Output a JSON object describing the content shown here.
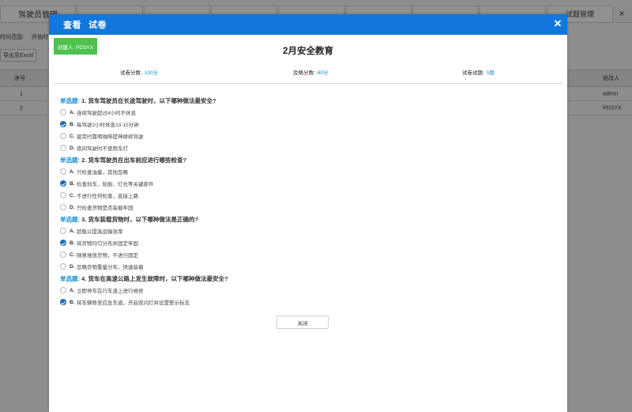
{
  "background": {
    "tabs": [
      "驾驶员管理",
      "",
      "",
      "",
      "",
      "",
      "",
      "",
      "试题管理"
    ],
    "tab_close": "×",
    "filter_label": "时间范围:",
    "filter_start": "开始时",
    "export_button": "导出至Excel",
    "table_headers": {
      "index": "序号",
      "modifier": "修改人"
    },
    "rows": [
      {
        "index": "1",
        "modifier": "admin"
      },
      {
        "index": "2",
        "modifier": "PDSYX"
      }
    ]
  },
  "modal": {
    "title_part1": "查看",
    "title_part2": "试卷",
    "close_icon": "×",
    "creator": "创建人: PDSYX",
    "paper_title": "2月安全教育",
    "meta": {
      "score_label": "试卷分数:",
      "score_value": "100分",
      "pass_label": "及格分数:",
      "pass_value": "60分",
      "count_label": "试卷试题:",
      "count_value": "5题"
    },
    "questions": [
      {
        "type": "单选题:",
        "number": "1.",
        "text": "货车驾驶员在长途驾驶时，以下哪种做法最安全?",
        "options": [
          {
            "letter": "A.",
            "text": "连续驾驶超过4小时不休息",
            "checked": false
          },
          {
            "letter": "B.",
            "text": "每驾驶2小时休息10-15分钟",
            "checked": true
          },
          {
            "letter": "C.",
            "text": "疲劳时靠喝咖啡提神继续驾驶",
            "checked": false
          },
          {
            "letter": "D.",
            "text": "夜间驾驶时不使用车灯",
            "checked": false
          }
        ]
      },
      {
        "type": "单选题:",
        "number": "2.",
        "text": "货车驾驶员在出车前应进行哪些检查?",
        "options": [
          {
            "letter": "A.",
            "text": "只检查油量，其他忽略",
            "checked": false
          },
          {
            "letter": "B.",
            "text": "检查刹车、轮胎、灯光等关键部件",
            "checked": true
          },
          {
            "letter": "C.",
            "text": "不进行任何检查，直接上路",
            "checked": false
          },
          {
            "letter": "D.",
            "text": "只检查货物是否装载牢固",
            "checked": false
          }
        ]
      },
      {
        "type": "单选题:",
        "number": "3.",
        "text": "货车装载货物时，以下哪种做法是正确的?",
        "options": [
          {
            "letter": "A.",
            "text": "超载以提高运输效率",
            "checked": false
          },
          {
            "letter": "B.",
            "text": "将货物均匀分布并固定牢固",
            "checked": true
          },
          {
            "letter": "C.",
            "text": "随意堆放货物，不进行固定",
            "checked": false
          },
          {
            "letter": "D.",
            "text": "忽略货物重量分布，快速装载",
            "checked": false
          }
        ]
      },
      {
        "type": "单选题:",
        "number": "4.",
        "text": "货车在高速公路上发生故障时，以下哪种做法最安全?",
        "options": [
          {
            "letter": "A.",
            "text": "立即停车在行车道上进行维修",
            "checked": false
          },
          {
            "letter": "B.",
            "text": "将车辆移至应急车道，开启双闪灯并设置警示标志",
            "checked": true
          }
        ]
      }
    ],
    "close_button": "关闭"
  }
}
